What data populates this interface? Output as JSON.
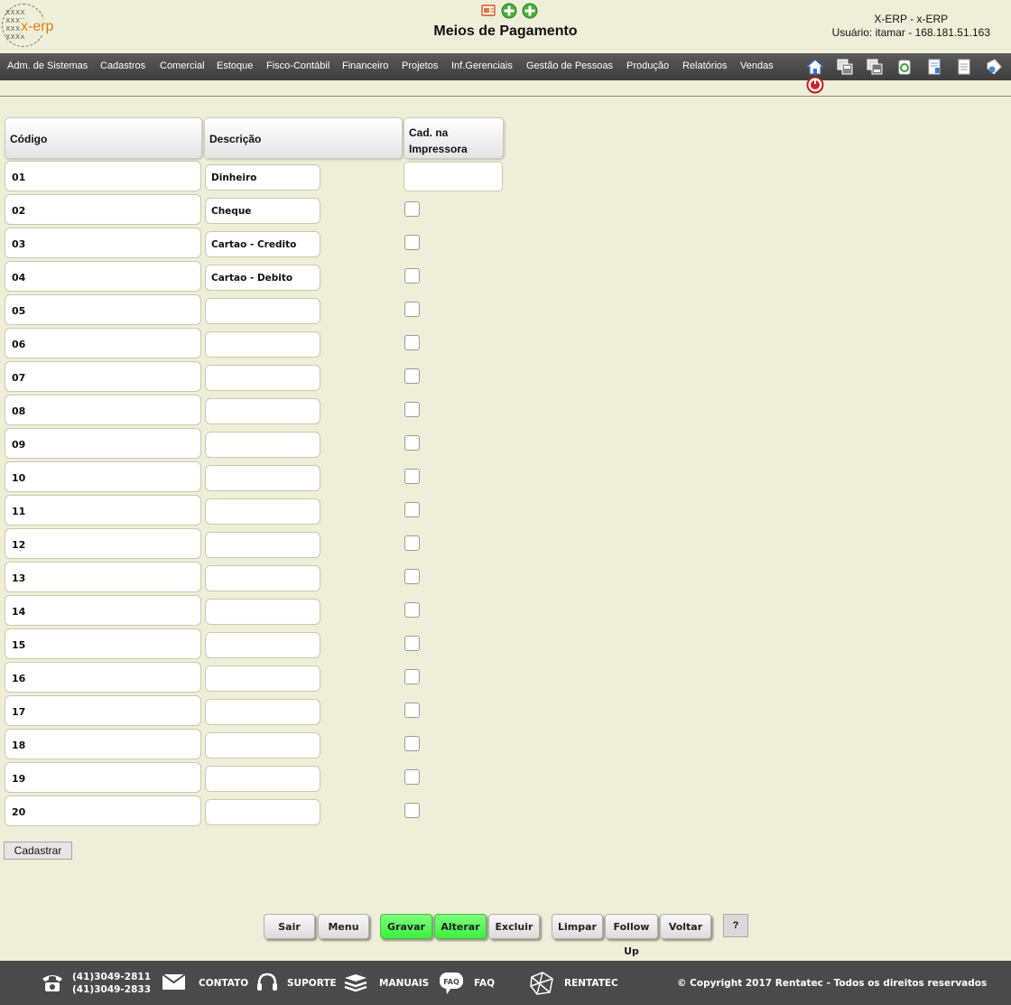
{
  "header": {
    "logo_text": "x-erp",
    "title": "Meios de Pagamento",
    "system_line": "X-ERP - x-ERP",
    "user_line": "Usuário: itamar - 168.181.51.163",
    "top_icons": [
      "presentation-icon",
      "add-icon",
      "add-icon"
    ]
  },
  "menu": {
    "items": [
      "Adm. de Sistemas",
      "Cadastros",
      "Comercial",
      "Estoque",
      "Fisco-Contábil",
      "Financeiro",
      "Projetos",
      "Inf.Gerenciais",
      "Gestão de Pessoas",
      "Produção",
      "Relatórios",
      "Vendas"
    ],
    "icons": [
      "home-icon",
      "copy-window-icon",
      "copy-window-icon",
      "recycle-icon",
      "document-edit-icon",
      "document-icon",
      "tag-icon",
      "power-icon"
    ]
  },
  "table": {
    "headers": {
      "codigo": "Código",
      "descricao": "Descrição",
      "cad_line1": "Cad. na",
      "cad_line2": "Impressora"
    },
    "rows": [
      {
        "codigo": "01",
        "descricao": "Dinheiro"
      },
      {
        "codigo": "02",
        "descricao": "Cheque"
      },
      {
        "codigo": "03",
        "descricao": "Cartao - Credito"
      },
      {
        "codigo": "04",
        "descricao": "Cartao - Debito"
      },
      {
        "codigo": "05",
        "descricao": ""
      },
      {
        "codigo": "06",
        "descricao": ""
      },
      {
        "codigo": "07",
        "descricao": ""
      },
      {
        "codigo": "08",
        "descricao": ""
      },
      {
        "codigo": "09",
        "descricao": ""
      },
      {
        "codigo": "10",
        "descricao": ""
      },
      {
        "codigo": "11",
        "descricao": ""
      },
      {
        "codigo": "12",
        "descricao": ""
      },
      {
        "codigo": "13",
        "descricao": ""
      },
      {
        "codigo": "14",
        "descricao": ""
      },
      {
        "codigo": "15",
        "descricao": ""
      },
      {
        "codigo": "16",
        "descricao": ""
      },
      {
        "codigo": "17",
        "descricao": ""
      },
      {
        "codigo": "18",
        "descricao": ""
      },
      {
        "codigo": "19",
        "descricao": ""
      },
      {
        "codigo": "20",
        "descricao": ""
      }
    ]
  },
  "cadastrar_label": "Cadastrar",
  "actions": {
    "sair": "Sair",
    "menu": "Menu",
    "gravar": "Gravar",
    "alterar": "Alterar",
    "excluir": "Excluir",
    "limpar": "Limpar",
    "follow_up": "Follow Up",
    "voltar": "Voltar",
    "help": "?"
  },
  "colors": {
    "background": "#efefd9",
    "menubar": "#4b4b4b",
    "green_button": "#4cf04c",
    "brand_orange": "#e07b18"
  },
  "footer": {
    "phone1": "(41)3049-2811",
    "phone2": "(41)3049-2833",
    "contato": "CONTATO",
    "suporte": "SUPORTE",
    "manuais": "MANUAIS",
    "faq": "FAQ",
    "faq_icon_text": "FAQ",
    "rentatec": "RENTATEC",
    "copyright": "© Copyright 2017 Rentatec - Todos os direitos reservados",
    "icons": [
      "phone-icon",
      "mail-icon",
      "headset-icon",
      "books-icon",
      "faq-icon",
      "network-icon"
    ]
  }
}
